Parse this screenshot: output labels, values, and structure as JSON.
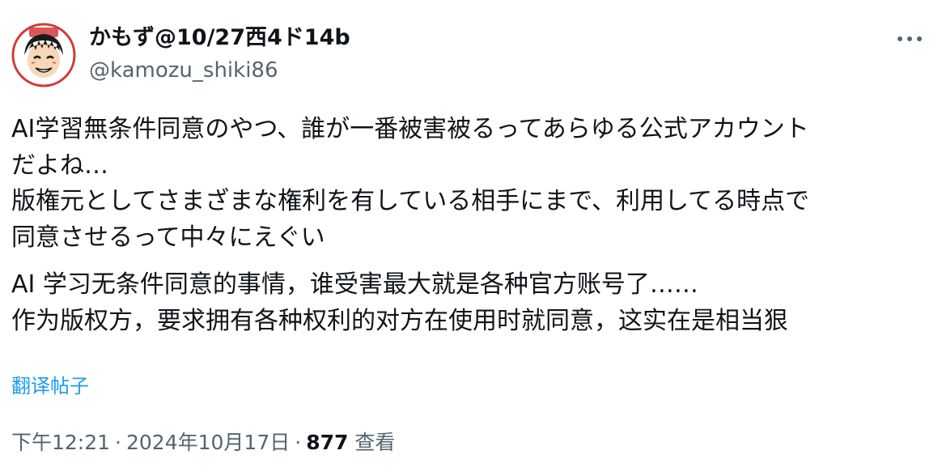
{
  "author": {
    "display_name": "かもず@10/27西4ド14b",
    "handle": "@kamozu_shiki86"
  },
  "tweet": {
    "original_text": "AI学習無条件同意のやつ、誰が一番被害被るってあらゆる公式アカウント\nだよね…\n版権元としてさまざまな権利を有している相手にまで、利用してる時点で\n同意させるって中々にえぐい",
    "translated_text": "AI 学习无条件同意的事情，谁受害最大就是各种官方账号了……\n作为版权方，要求拥有各种权利的对方在使用时就同意，这实在是相当狠",
    "translate_link": "翻译帖子"
  },
  "meta": {
    "time": "下午12:21",
    "separator": "·",
    "date": "2024年10月17日",
    "views_count": "877",
    "views_label": "查看"
  },
  "icons": {
    "avatar": "user-avatar",
    "more": "more-horizontal-icon"
  },
  "colors": {
    "text": "#0f1419",
    "secondary": "#536471",
    "link": "#1d9bf0"
  }
}
